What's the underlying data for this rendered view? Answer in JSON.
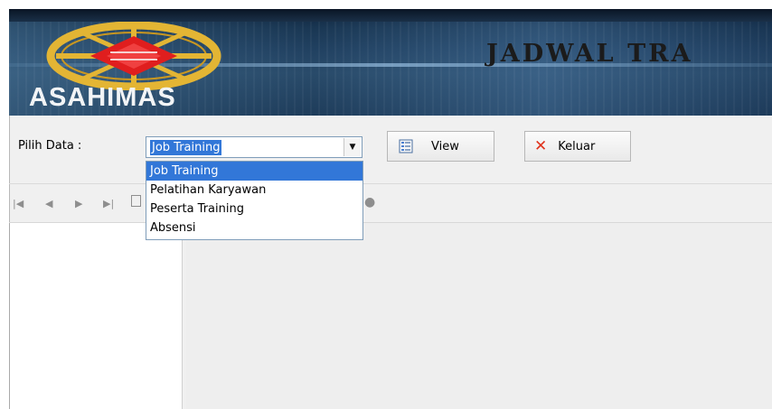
{
  "banner": {
    "company": "ASAHIMAS",
    "app_title": "JADWAL TRA"
  },
  "filter": {
    "label": "Pilih Data :",
    "selected": "Job Training",
    "options": [
      "Job Training",
      "Pelatihan Karyawan",
      "Peserta Training",
      "Absensi"
    ]
  },
  "buttons": {
    "view": "View",
    "exit": "Keluar"
  },
  "icons": {
    "view": "list-icon",
    "exit": "close-icon",
    "dropdown": "chevron-down-icon",
    "nav_first": "first-page-icon",
    "nav_prev": "previous-page-icon",
    "nav_next": "next-page-icon",
    "nav_last": "last-page-icon",
    "export": "export-icon",
    "search": "binoculars-icon"
  },
  "colors": {
    "selection": "#3277d8",
    "logo_red": "#e01e1e",
    "logo_gold": "#e3b534",
    "exit_icon": "#e0321c"
  }
}
